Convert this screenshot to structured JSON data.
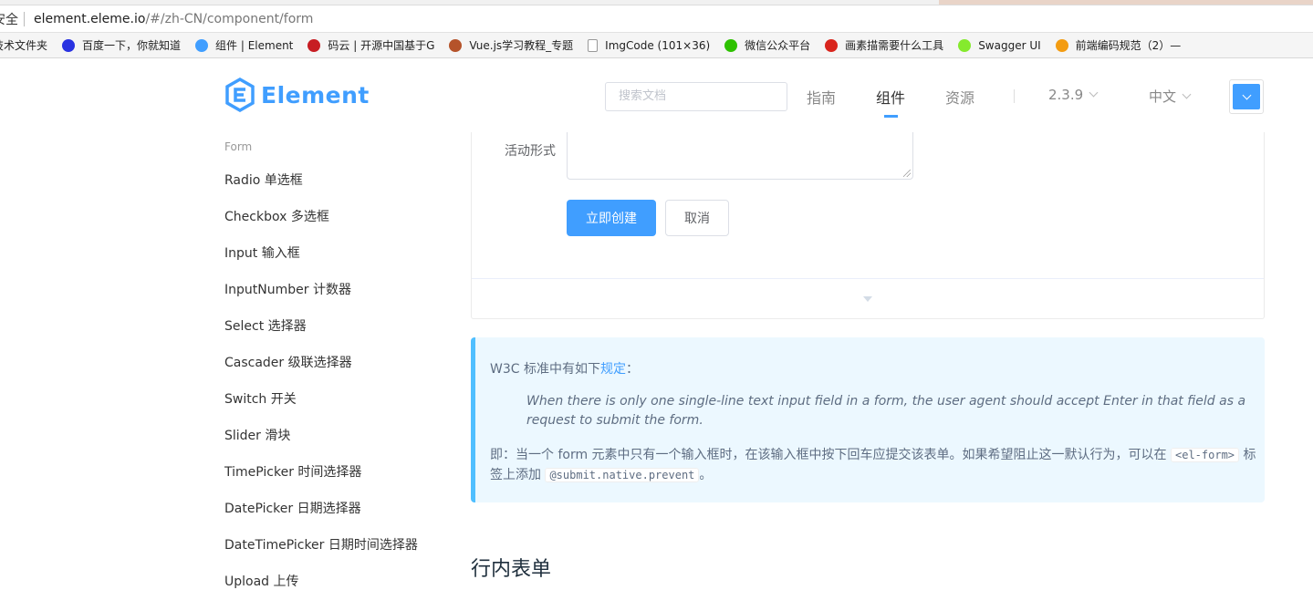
{
  "browser": {
    "secure_label": "安全",
    "url_host": "element.eleme.io",
    "url_path": "/#/zh-CN/component/form",
    "bookmarks": [
      {
        "label": "技术文件夹",
        "icon": "folder-icon",
        "color": "#f0c040"
      },
      {
        "label": "百度一下，你就知道",
        "icon": "baidu-paw-icon",
        "color": "#2932e1"
      },
      {
        "label": "组件 | Element",
        "icon": "element-icon",
        "color": "#409eff"
      },
      {
        "label": "码云 | 开源中国基于G",
        "icon": "gitee-icon",
        "color": "#c71d23"
      },
      {
        "label": "Vue.js学习教程_专题",
        "icon": "vue-icon",
        "color": "#b5532a"
      },
      {
        "label": "ImgCode (101×36)",
        "icon": "page-icon",
        "color": "#ffffff"
      },
      {
        "label": "微信公众平台",
        "icon": "wechat-icon",
        "color": "#2dc100"
      },
      {
        "label": "画素描需要什么工具",
        "icon": "site-icon",
        "color": "#d9251d"
      },
      {
        "label": "Swagger UI",
        "icon": "swagger-icon",
        "color": "#85ea2d"
      },
      {
        "label": "前端编码规范（2）—",
        "icon": "code-icon",
        "color": "#f39c12"
      }
    ]
  },
  "header": {
    "logo_text": "Element",
    "search_placeholder": "搜索文档",
    "nav": [
      "指南",
      "组件",
      "资源"
    ],
    "active_nav": "组件",
    "version": "2.3.9",
    "language": "中文",
    "accent": "#409eff"
  },
  "sidebar": {
    "group": "Form",
    "items": [
      "Radio 单选框",
      "Checkbox 多选框",
      "Input 输入框",
      "InputNumber 计数器",
      "Select 选择器",
      "Cascader 级联选择器",
      "Switch 开关",
      "Slider 滑块",
      "TimePicker 时间选择器",
      "DatePicker 日期选择器",
      "DateTimePicker 日期时间选择器",
      "Upload 上传"
    ]
  },
  "demo": {
    "field_label": "活动形式",
    "submit_label": "立即创建",
    "cancel_label": "取消"
  },
  "tip": {
    "line1_prefix": "W3C 标准中有如下",
    "line1_link": "规定",
    "line1_suffix": "：",
    "quote": "When there is only one single-line text input field in a form, the user agent should accept Enter in that field as a request to submit the form.",
    "p2_prefix": "即：当一个 form 元素中只有一个输入框时，在该输入框中按下回车应提交该表单。如果希望阻止这一默认行为，可以在",
    "p2_code1": "<el-form>",
    "p2_middle": "标签上添加",
    "p2_code2": "@submit.native.prevent",
    "p2_suffix": "。"
  },
  "section": {
    "title": "行内表单"
  }
}
